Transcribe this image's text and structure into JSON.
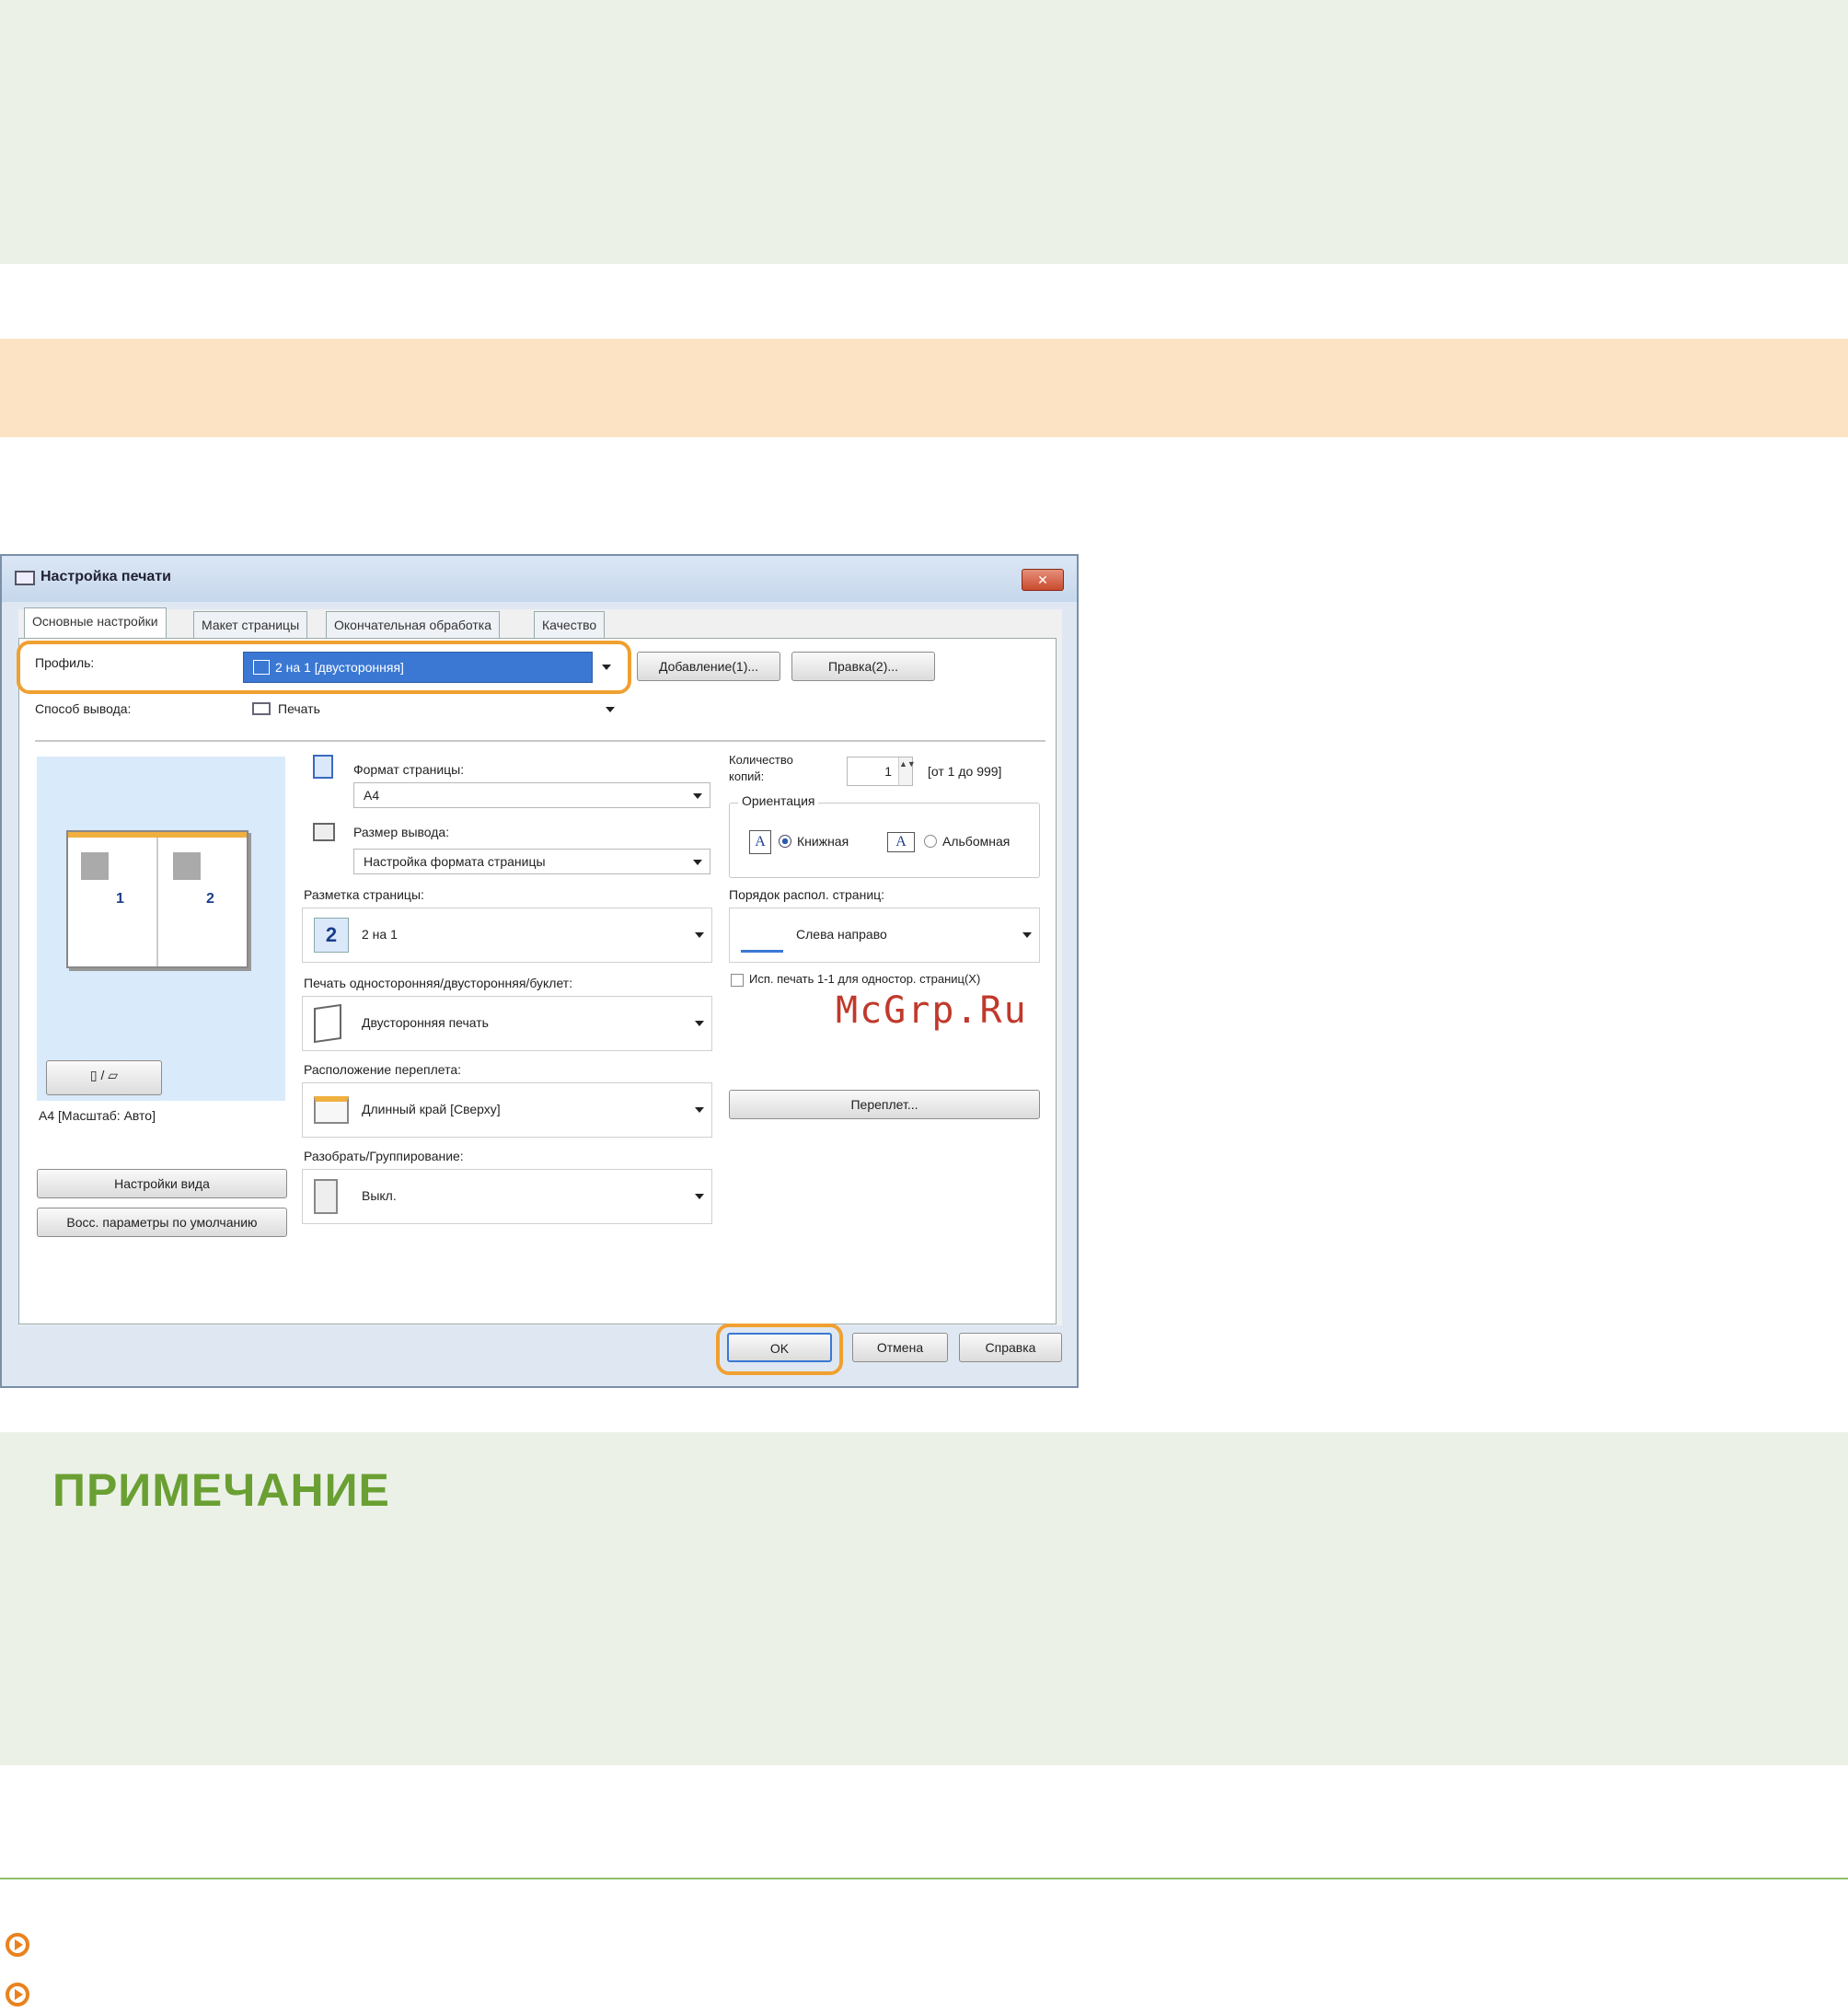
{
  "note": {
    "title": "ПРИМЕЧАНИЕ"
  },
  "watermark": "McGrp.Ru",
  "dialog": {
    "title": "Настройка печати",
    "close_label": "✕",
    "tabs": [
      {
        "label": "Основные настройки"
      },
      {
        "label": "Макет страницы"
      },
      {
        "label": "Окончательная обработка"
      },
      {
        "label": "Качество"
      }
    ],
    "profile": {
      "label": "Профиль:",
      "value": "2 на 1 [двусторонняя]",
      "add_button": "Добавление(1)...",
      "edit_button": "Правка(2)..."
    },
    "output": {
      "label": "Способ вывода:",
      "value": "Печать"
    },
    "preview": {
      "page_numbers": [
        "1",
        "2"
      ],
      "caption": "A4 [Масштаб: Авто]",
      "view_settings_button": "Настройки вида",
      "restore_defaults_button": "Восс. параметры по умолчанию"
    },
    "page_size": {
      "label": "Формат страницы:",
      "value": "A4"
    },
    "output_size": {
      "label": "Размер вывода:",
      "value": "Настройка формата страницы"
    },
    "page_layout": {
      "label": "Разметка страницы:",
      "value": "2 на 1",
      "icon_text": "2"
    },
    "duplex": {
      "label": "Печать односторонняя/двусторонняя/буклет:",
      "value": "Двусторонняя печать"
    },
    "binding": {
      "label": "Расположение переплета:",
      "value": "Длинный край [Сверху]"
    },
    "collate": {
      "label": "Разобрать/Группирование:",
      "value": "Выкл."
    },
    "copies": {
      "label_line1": "Количество",
      "label_line2": "копий:",
      "value": "1",
      "range": "[от 1 до 999]"
    },
    "orientation": {
      "label": "Ориентация",
      "portrait": "Книжная",
      "landscape": "Альбомная",
      "icon_letter": "A"
    },
    "page_order": {
      "label": "Порядок распол. страниц:",
      "value": "Слева направо"
    },
    "one_to_one": {
      "label": "Исп. печать 1-1 для одностор. страниц(X)"
    },
    "binding_button": "Переплет...",
    "ok_button": "OK",
    "cancel_button": "Отмена",
    "help_button": "Справка"
  },
  "colors": {
    "highlight": "#f0a030",
    "note_green": "#6aa033",
    "bullet": "#e9821e"
  }
}
